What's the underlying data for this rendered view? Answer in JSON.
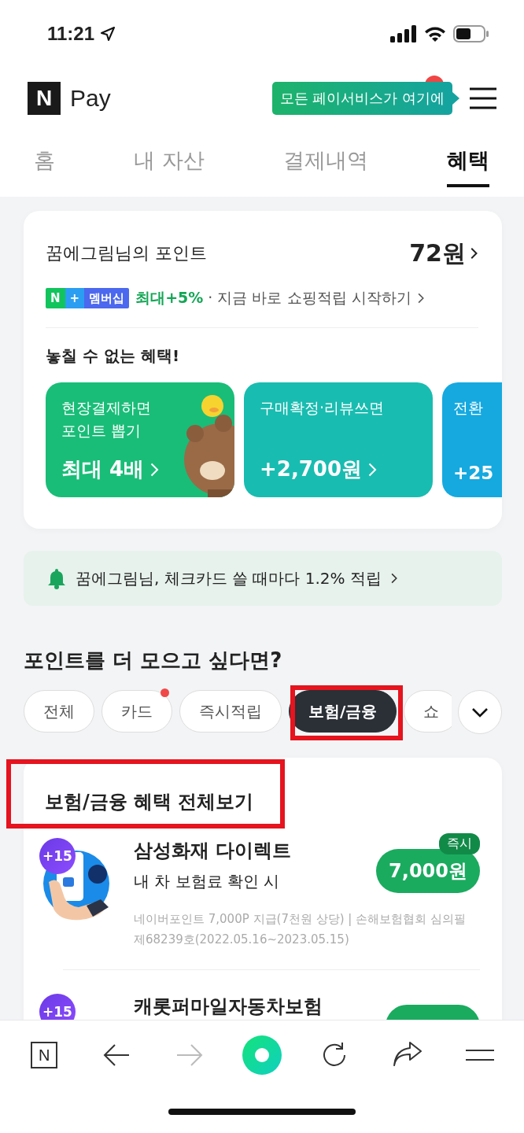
{
  "status_bar": {
    "time": "11:21"
  },
  "header": {
    "logo_mark": "N",
    "logo_text": "Pay",
    "tooltip": "모든 페이서비스가 여기에",
    "menu_badge": true
  },
  "tabs": [
    {
      "label": "홈",
      "selected": false
    },
    {
      "label": "내 자산",
      "selected": false
    },
    {
      "label": "결제내역",
      "selected": false
    },
    {
      "label": "혜택",
      "selected": true
    }
  ],
  "points_card": {
    "title": "꿈에그림님의 포인트",
    "amount": "72원",
    "membership": {
      "badge": [
        {
          "text": "N",
          "color": "#12c45c"
        },
        {
          "text": "+",
          "color": "#2b9ef2"
        },
        {
          "text": "멤버십",
          "color": "#4b68ee"
        }
      ],
      "highlight": "최대+5%",
      "text": "· 지금 바로 쇼핑적립 시작하기"
    },
    "benefits_title": "놓칠 수 없는 혜택!",
    "benefits": [
      {
        "kind": "picture",
        "lines": [
          "현장결제하면",
          "포인트 뽑기"
        ],
        "value": "최대 4배",
        "color": "#19bd78"
      },
      {
        "kind": "plain",
        "lines": [
          "구매확정·리뷰쓰면"
        ],
        "value": "+2,700원",
        "color": "#19bcb0"
      },
      {
        "kind": "plain",
        "lines": [
          "전환"
        ],
        "value": "+25",
        "color": "#15a9e0"
      }
    ]
  },
  "notice": {
    "text": "꿈에그림님, 체크카드 쓸 때마다 1.2% 적립"
  },
  "more": {
    "title": "포인트를 더 모으고 싶다면?",
    "chips": [
      {
        "label": "전체",
        "selected": false,
        "dot": false,
        "highlighted": false
      },
      {
        "label": "카드",
        "selected": false,
        "dot": true,
        "highlighted": false
      },
      {
        "label": "즉시적립",
        "selected": false,
        "dot": false,
        "highlighted": false
      },
      {
        "label": "보험/금융",
        "selected": true,
        "dot": false,
        "highlighted": true
      },
      {
        "label": "쇼",
        "selected": false,
        "dot": false,
        "highlighted": false
      }
    ],
    "list_title": "보험/금융 혜택 전체보기",
    "list_title_highlighted": true,
    "items": [
      {
        "badge": "+15",
        "title": "삼성화재 다이렉트",
        "subtitle": "내 차 보험료 확인 시",
        "note": "네이버포인트 7,000P 지급(7천원 상당) | 손해보험협회 심의필 제68239호(2022.05.16~2023.05.15)",
        "tag": "즉시",
        "reward": "7,000원"
      },
      {
        "badge": "+15",
        "title": "캐롯퍼마일자동차보험"
      }
    ]
  },
  "toolbar": {
    "logo_mark": "N",
    "forward_disabled": true
  }
}
